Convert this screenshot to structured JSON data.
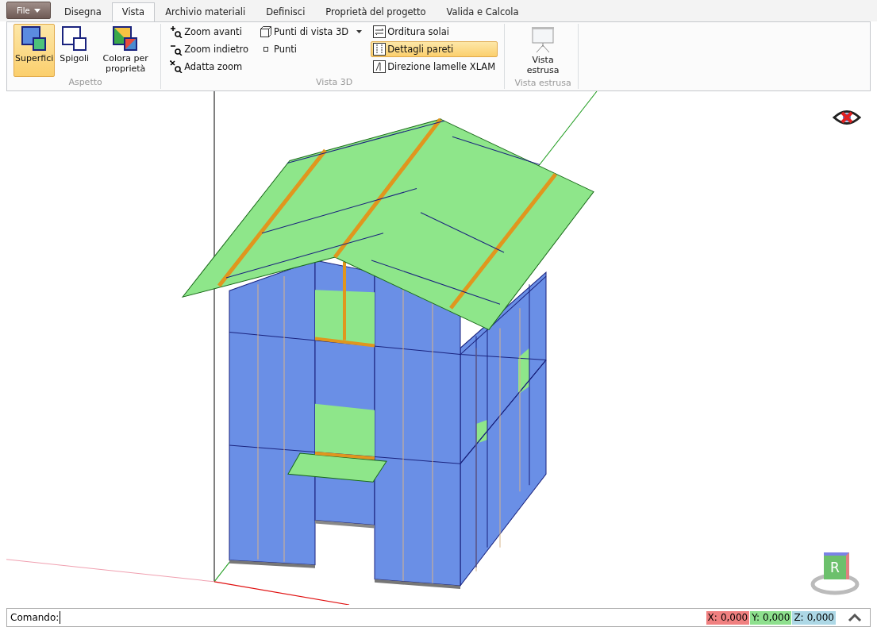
{
  "file_menu": {
    "label": "File"
  },
  "tabs": [
    {
      "label": "Disegna",
      "selected": false
    },
    {
      "label": "Vista",
      "selected": true
    },
    {
      "label": "Archivio materiali",
      "selected": false
    },
    {
      "label": "Definisci",
      "selected": false
    },
    {
      "label": "Proprietà del progetto",
      "selected": false
    },
    {
      "label": "Valida e Calcola",
      "selected": false
    }
  ],
  "aspetto": {
    "title": "Aspetto",
    "buttons": [
      {
        "label": "Superfici",
        "selected": true
      },
      {
        "label": "Spigoli",
        "selected": false
      },
      {
        "label": "Colora per proprietà",
        "selected": false
      }
    ]
  },
  "vista_3d": {
    "title": "Vista 3D",
    "zoom": [
      "Zoom avanti",
      "Zoom indietro",
      "Adatta zoom"
    ],
    "views": [
      "Punti di vista 3D",
      "Punti"
    ],
    "details": [
      {
        "label": "Orditura solai",
        "selected": false
      },
      {
        "label": "Dettagli pareti",
        "selected": true
      },
      {
        "label": "Direzione lamelle XLAM",
        "selected": false
      }
    ]
  },
  "vista_estrusa": {
    "title": "Vista estrusa",
    "button": "Vista estrusa"
  },
  "viewport": {
    "nav_cube_label": "R"
  },
  "command_bar": {
    "label": "Comando:",
    "coordinates": [
      {
        "axis": "X:",
        "value": "0,000",
        "color": "#f08080"
      },
      {
        "axis": "Y:",
        "value": "0,000",
        "color": "#8ee08e"
      },
      {
        "axis": "Z:",
        "value": "0,000",
        "color": "#add8e6"
      }
    ]
  }
}
